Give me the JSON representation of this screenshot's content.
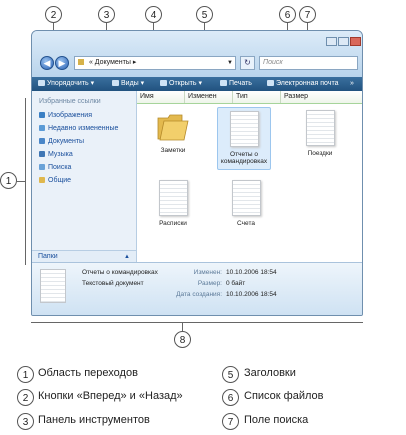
{
  "window": {
    "address_text": "« Документы ▸",
    "search_placeholder": "Поиск",
    "nav_back": "◀",
    "nav_forward": "▶",
    "refresh": "↻"
  },
  "toolbar": {
    "organize": "Упорядочить",
    "views": "Виды",
    "open": "Открыть",
    "print": "Печать",
    "email": "Электронная почта",
    "more": "»"
  },
  "sidebar": {
    "title": "Избранные ссылки",
    "items": [
      {
        "label": "Изображения",
        "icon": "pictures-icon"
      },
      {
        "label": "Недавно измененные",
        "icon": "recent-icon"
      },
      {
        "label": "Документы",
        "icon": "documents-icon"
      },
      {
        "label": "Музыка",
        "icon": "music-icon"
      },
      {
        "label": "Поиска",
        "icon": "search-folder-icon"
      },
      {
        "label": "Общие",
        "icon": "public-icon"
      }
    ],
    "folders_label": "Папки",
    "folders_chevron": "▲"
  },
  "columns": {
    "name": "Имя",
    "modified": "Изменен",
    "type": "Тип",
    "size": "Размер"
  },
  "files": [
    {
      "name": "Заметки",
      "kind": "folder"
    },
    {
      "name": "Отчеты о командировках",
      "kind": "document",
      "selected": true
    },
    {
      "name": "Поездки",
      "kind": "document"
    },
    {
      "name": "Расписки",
      "kind": "document"
    },
    {
      "name": "Счета",
      "kind": "document"
    }
  ],
  "details": {
    "name": "Отчеты о командировках",
    "type": "Текстовый документ",
    "modified_label": "Изменен:",
    "modified_value": "10.10.2006 18:54",
    "size_label": "Размер:",
    "size_value": "0 байт",
    "created_label": "Дата создания:",
    "created_value": "10.10.2006 18:54"
  },
  "callouts": {
    "c1": "1",
    "c2": "2",
    "c3": "3",
    "c4": "4",
    "c5": "5",
    "c6": "6",
    "c7": "7",
    "c8": "8"
  },
  "legend": [
    {
      "num": "1",
      "text": "Область переходов"
    },
    {
      "num": "2",
      "text": "Кнопки «Вперед» и «Назад»"
    },
    {
      "num": "3",
      "text": "Панель инструментов"
    },
    {
      "num": "5",
      "text": "Заголовки"
    },
    {
      "num": "6",
      "text": "Список файлов"
    },
    {
      "num": "7",
      "text": "Поле поиска"
    }
  ],
  "colors": {
    "accent": "#2a62b4",
    "toolbar": "#2b5f8d",
    "link": "#1a4f9c"
  }
}
